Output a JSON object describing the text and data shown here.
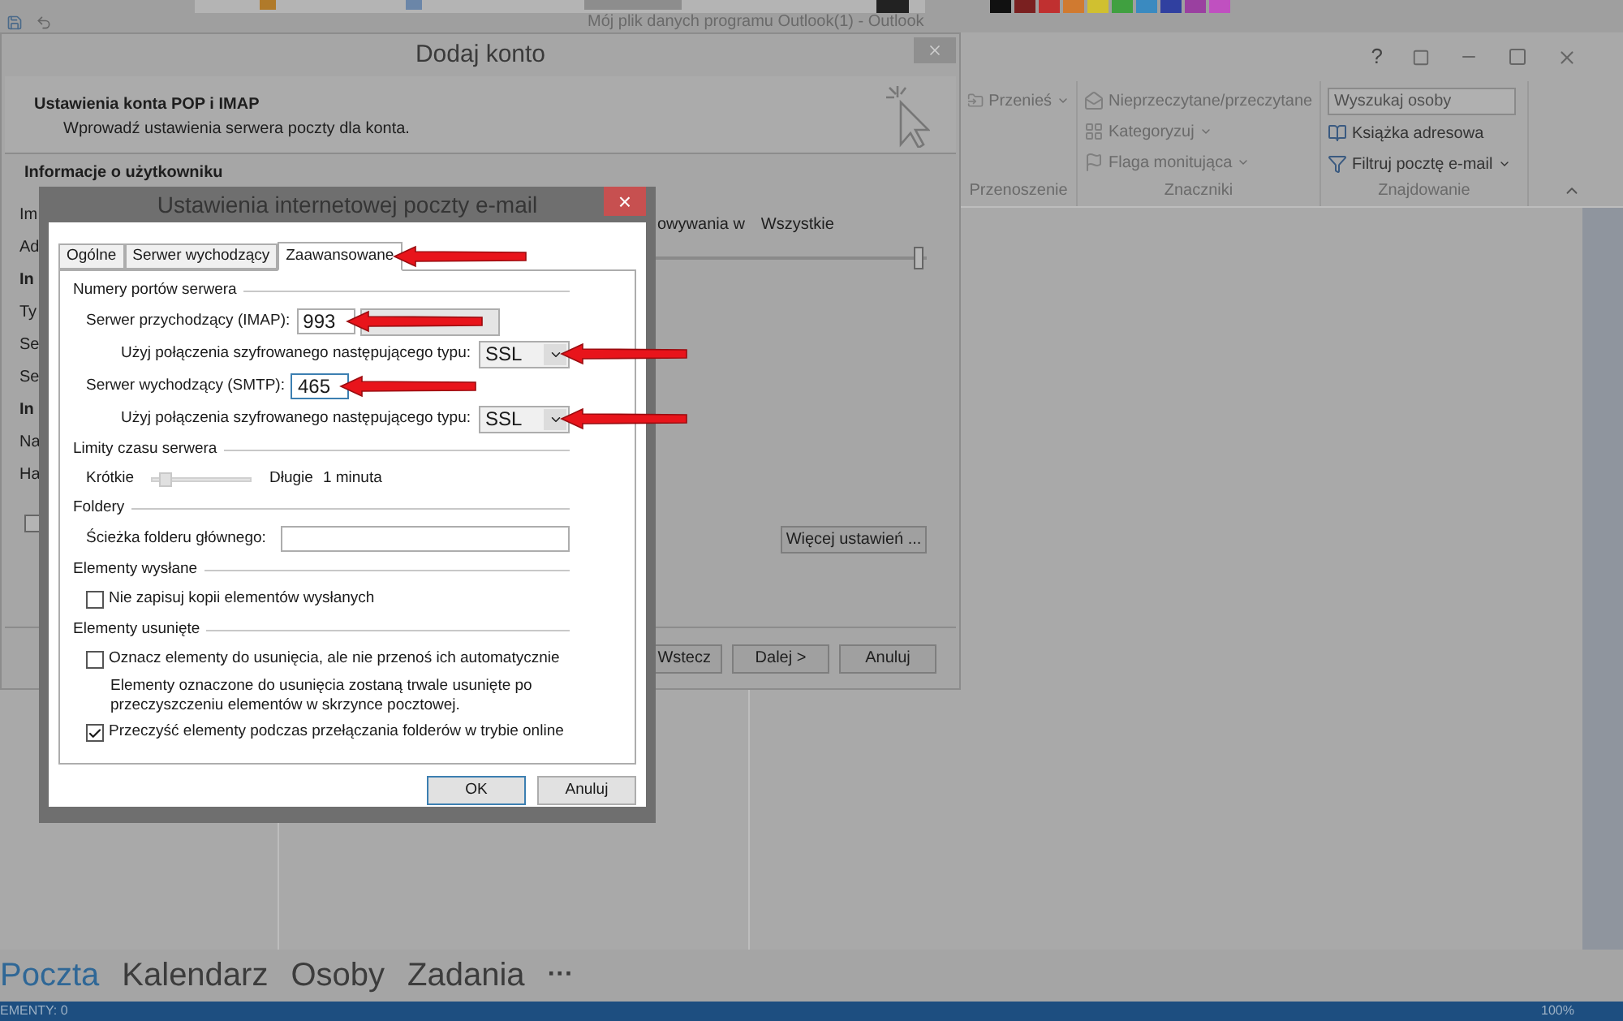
{
  "outlook": {
    "title": "Mój plik danych programu Outlook(1) - Outlook",
    "window_help": "?",
    "ribbon": [
      {
        "label": "Przenoszenie",
        "items": [
          {
            "label": "Przenieś",
            "dropdown": true
          }
        ]
      },
      {
        "label": "Znaczniki",
        "items": [
          {
            "label": "Nieprzeczytane/przeczytane",
            "dropdown": false
          },
          {
            "label": "Kategoryzuj",
            "dropdown": true
          },
          {
            "label": "Flaga monitująca",
            "dropdown": true
          }
        ]
      },
      {
        "label": "Znajdowanie",
        "search": {
          "placeholder": "Wyszukaj osoby"
        },
        "items": [
          {
            "label": "Książka adresowa",
            "dropdown": false
          },
          {
            "label": "Filtruj pocztę e-mail",
            "dropdown": true
          }
        ]
      }
    ],
    "nav": [
      {
        "label": "Poczta",
        "selected": true
      },
      {
        "label": "Kalendarz",
        "selected": false
      },
      {
        "label": "Osoby",
        "selected": false
      },
      {
        "label": "Zadania",
        "selected": false
      }
    ],
    "nav_more": "···",
    "status_bar": {
      "items": "EMENTY: 0",
      "zoom": "100%"
    }
  },
  "add_account": {
    "title": "Dodaj konto",
    "heading": "Ustawienia konta POP i IMAP",
    "subheading": "Wprowadź ustawienia serwera poczty dla konta.",
    "section": "Informacje o użytkowniku",
    "fragments": [
      {
        "text": "Im",
        "kind": "label"
      },
      {
        "text": "Ad",
        "kind": "label"
      },
      {
        "text": "In",
        "kind": "heading"
      },
      {
        "text": "Ty",
        "kind": "label"
      },
      {
        "text": "Se",
        "kind": "label"
      },
      {
        "text": "Se",
        "kind": "label"
      },
      {
        "text": "In",
        "kind": "heading"
      },
      {
        "text": "Na",
        "kind": "label"
      },
      {
        "text": "Ha",
        "kind": "label"
      }
    ],
    "checkbox": {
      "checked": false
    },
    "right_texts": [
      "owywania w",
      "Wszystkie"
    ],
    "slider": {
      "level": 0.97
    },
    "more_button": "Więcej ustawień ...",
    "buttons": [
      "Wstecz",
      "Dalej >",
      "Anuluj"
    ]
  },
  "settings": {
    "title": "Ustawienia internetowej poczty e-mail",
    "close": "×",
    "tabs": [
      {
        "label": "Ogólne",
        "selected": false
      },
      {
        "label": "Serwer wychodzący",
        "selected": false
      },
      {
        "label": "Zaawansowane",
        "selected": true
      }
    ],
    "sections": [
      {
        "title": "Numery portów serwera",
        "rows": [
          {
            "kind": "port_button",
            "label": "Serwer przychodzący (IMAP):",
            "value": "993",
            "focused": false
          },
          {
            "kind": "select",
            "label": "Użyj połączenia szyfrowanego następującego typu:",
            "value": "SSL"
          },
          {
            "kind": "port",
            "label": "Serwer wychodzący (SMTP):",
            "value": "465",
            "focused": true
          },
          {
            "kind": "select",
            "label": "Użyj połączenia szyfrowanego następującego typu:",
            "value": "SSL"
          }
        ]
      },
      {
        "title": "Limity czasu serwera",
        "rows": [
          {
            "kind": "slider",
            "low": "Krótkie",
            "high": "Długie",
            "reading": "1 minuta",
            "level": 0.15
          }
        ]
      },
      {
        "title": "Foldery",
        "rows": [
          {
            "kind": "field",
            "label": "Ścieżka folderu głównego:"
          }
        ]
      },
      {
        "title": "Elementy wysłane",
        "rows": [
          {
            "kind": "checkbox",
            "label": "Nie zapisuj kopii elementów wysłanych",
            "checked": false
          }
        ]
      },
      {
        "title": "Elementy usunięte",
        "rows": [
          {
            "kind": "checkbox",
            "label": "Oznacz elementy do usunięcia, ale nie przenoś ich automatycznie",
            "checked": false
          },
          {
            "kind": "note",
            "text": "Elementy oznaczone do usunięcia zostaną trwale usunięte po przeczyszczeniu elementów w skrzynce pocztowej."
          },
          {
            "kind": "checkbox",
            "label": "Przeczyść elementy podczas przełączania folderów w trybie online",
            "checked": true
          }
        ]
      }
    ],
    "buttons": [
      {
        "label": "OK",
        "default": true
      },
      {
        "label": "Anuluj",
        "default": false
      }
    ]
  }
}
